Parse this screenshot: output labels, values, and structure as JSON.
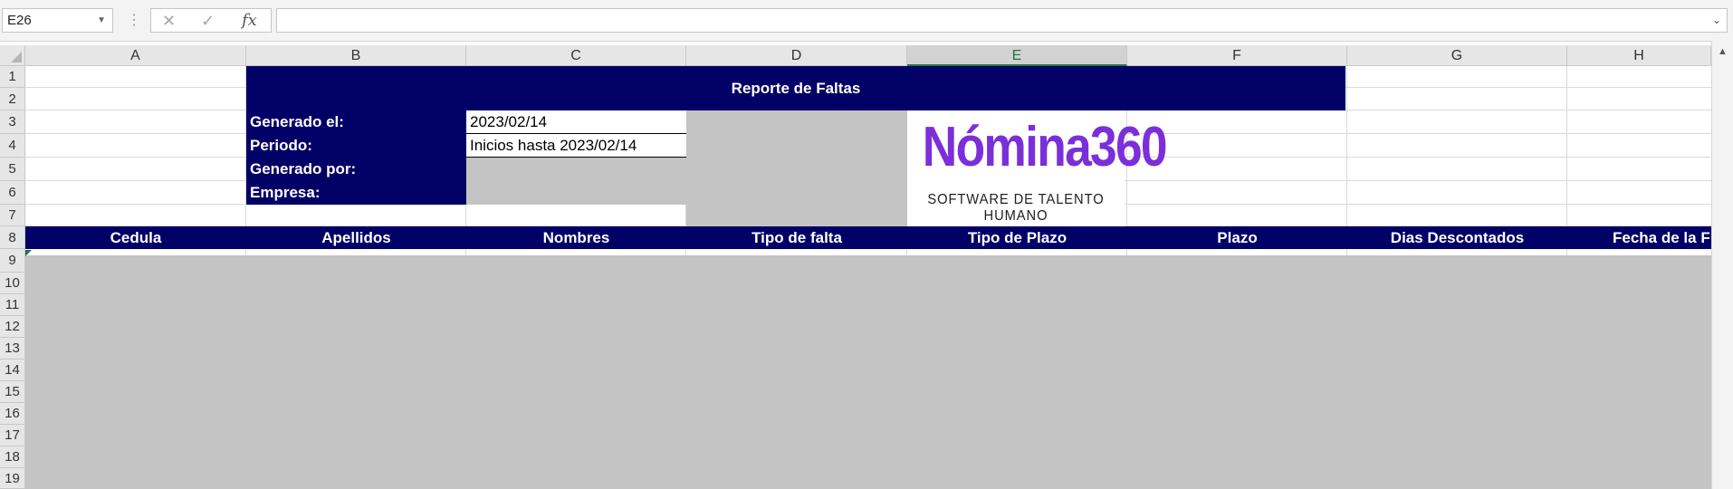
{
  "formula_bar": {
    "name_box": "E26",
    "formula": "",
    "cancel_icon": "✕",
    "enter_icon": "✓",
    "fx_label": "fx"
  },
  "columns": [
    "A",
    "B",
    "C",
    "D",
    "E",
    "F",
    "G",
    "H"
  ],
  "selected_column": "E",
  "rows": [
    "1",
    "2",
    "3",
    "4",
    "5",
    "6",
    "7",
    "8",
    "9",
    "10",
    "11",
    "12",
    "13",
    "14",
    "15",
    "16",
    "17",
    "18",
    "19"
  ],
  "report": {
    "title": "Reporte de Faltas",
    "generated_on_label": "Generado el:",
    "generated_on_value": "2023/02/14",
    "period_label": "Periodo:",
    "period_value": "Inicios hasta 2023/02/14",
    "generated_by_label": "Generado por:",
    "company_label": "Empresa:"
  },
  "logo": {
    "name": "Nómina360",
    "tagline": "SOFTWARE DE TALENTO HUMANO",
    "color": "#7b2fd9"
  },
  "table_headers": [
    "Cedula",
    "Apellidos",
    "Nombres",
    "Tipo de falta",
    "Tipo de Plazo",
    "Plazo",
    "Dias Descontados",
    "Fecha de la F"
  ],
  "colors": {
    "header_fill": "#000066",
    "empty_fill": "#c4c4c4",
    "accent": "#217346"
  }
}
